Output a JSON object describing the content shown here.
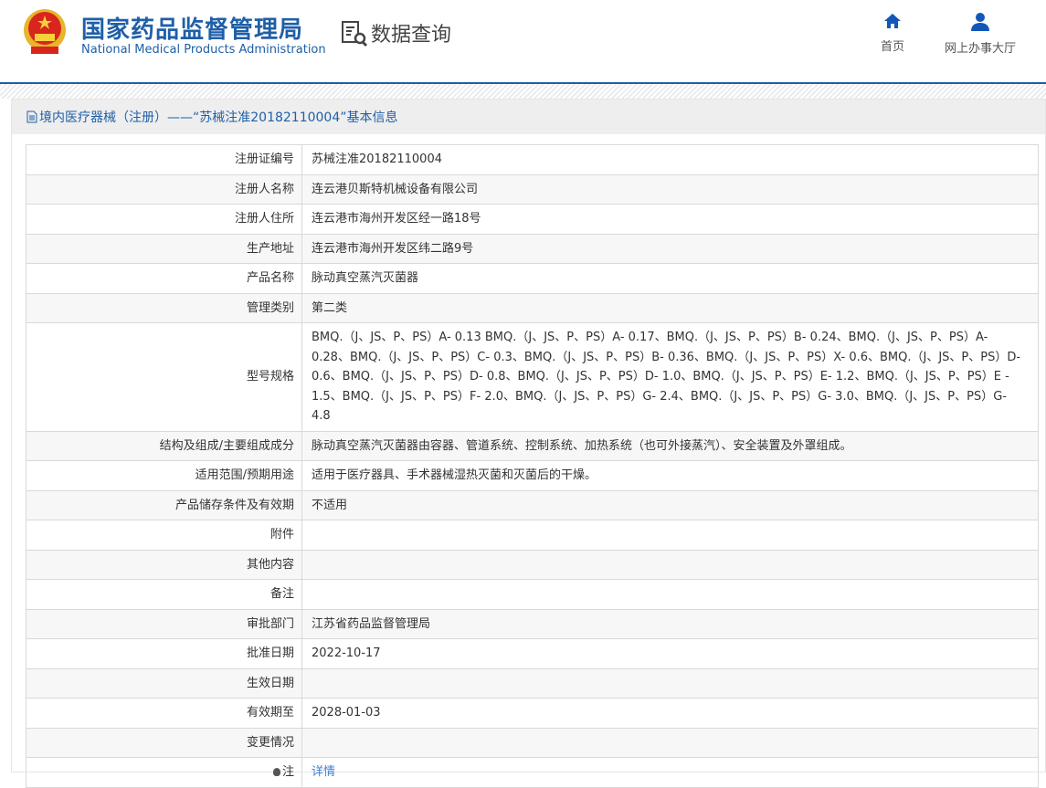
{
  "header": {
    "brand_cn": "国家药品监督管理局",
    "brand_en": "National Medical Products Administration",
    "section": "数据查询",
    "nav": [
      {
        "label": "首页",
        "icon": "home-icon"
      },
      {
        "label": "网上办事大厅",
        "icon": "user-icon"
      }
    ]
  },
  "panel": {
    "title": "境内医疗器械（注册）——“苏械注准20182110004”基本信息"
  },
  "rows": [
    {
      "label": "注册证编号",
      "value": "苏械注准20182110004"
    },
    {
      "label": "注册人名称",
      "value": "连云港贝斯特机械设备有限公司"
    },
    {
      "label": "注册人住所",
      "value": "连云港市海州开发区经一路18号"
    },
    {
      "label": "生产地址",
      "value": "连云港市海州开发区纬二路9号"
    },
    {
      "label": "产品名称",
      "value": "脉动真空蒸汽灭菌器"
    },
    {
      "label": "管理类别",
      "value": "第二类"
    },
    {
      "label": "型号规格",
      "value": "BMQ.（J、JS、P、PS）A- 0.13 BMQ.（J、JS、P、PS）A- 0.17、BMQ.（J、JS、P、PS）B- 0.24、BMQ.（J、JS、P、PS）A- 0.28、BMQ.（J、JS、P、PS）C- 0.3、BMQ.（J、JS、P、PS）B- 0.36、BMQ.（J、JS、P、PS）X- 0.6、BMQ.（J、JS、P、PS）D- 0.6、BMQ.（J、JS、P、PS）D- 0.8、BMQ.（J、JS、P、PS）D- 1.0、BMQ.（J、JS、P、PS）E- 1.2、BMQ.（J、JS、P、PS）E - 1.5、BMQ.（J、JS、P、PS）F- 2.0、BMQ.（J、JS、P、PS）G- 2.4、BMQ.（J、JS、P、PS）G- 3.0、BMQ.（J、JS、P、PS）G- 4.8"
    },
    {
      "label": "结构及组成/主要组成成分",
      "value": "脉动真空蒸汽灭菌器由容器、管道系统、控制系统、加热系统（也可外接蒸汽）、安全装置及外罩组成。"
    },
    {
      "label": "适用范围/预期用途",
      "value": "适用于医疗器具、手术器械湿热灭菌和灭菌后的干燥。"
    },
    {
      "label": "产品储存条件及有效期",
      "value": "不适用"
    },
    {
      "label": "附件",
      "value": ""
    },
    {
      "label": "其他内容",
      "value": ""
    },
    {
      "label": "备注",
      "value": ""
    },
    {
      "label": "审批部门",
      "value": "江苏省药品监督管理局"
    },
    {
      "label": "批准日期",
      "value": "2022-10-17"
    },
    {
      "label": "生效日期",
      "value": ""
    },
    {
      "label": "有效期至",
      "value": "2028-01-03"
    },
    {
      "label": "变更情况",
      "value": ""
    }
  ],
  "note": {
    "label": "注",
    "link": "详情"
  }
}
